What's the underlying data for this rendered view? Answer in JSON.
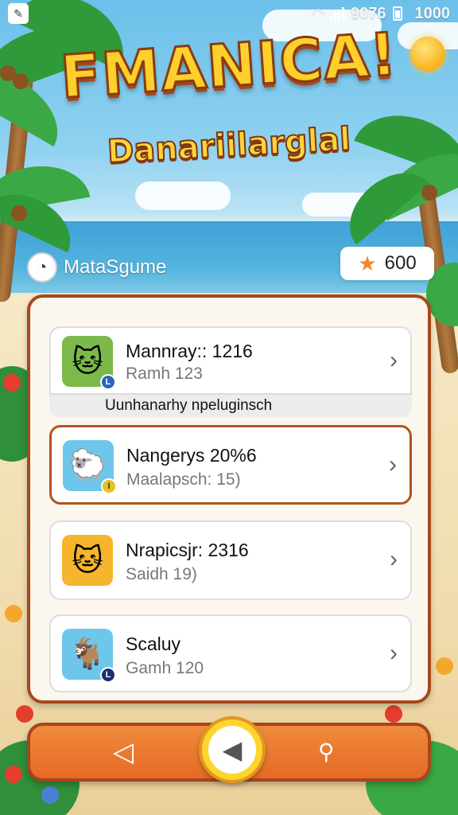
{
  "status_bar": {
    "time_text": "9076",
    "right_text": "1000"
  },
  "logo": {
    "title": "FMANICA!",
    "subtitle": "Danariilarglal"
  },
  "user": {
    "name": "MataSgume"
  },
  "coins": {
    "value": "600"
  },
  "list": [
    {
      "title": "Mannray:: 1216",
      "subtitle": "Ramh 123",
      "footer": "Uunhanarhy npeluginsch",
      "thumb_icon": "cat-icon",
      "thumb_bg": "#7bb94a",
      "badge": "L",
      "badge_color": "#2a63b8",
      "selected": false
    },
    {
      "title": "Nangerys 20%6",
      "subtitle": "Maalapsch: 15)",
      "thumb_icon": "sheep-icon",
      "thumb_bg": "#6ec7ea",
      "badge": "I",
      "badge_color": "#e6c21a",
      "selected": true
    },
    {
      "title": "Nrapicsjr: 2316",
      "subtitle": "Saidh 19)",
      "thumb_icon": "cat-icon",
      "thumb_bg": "#f5b52c",
      "badge": "",
      "badge_color": "",
      "selected": false
    },
    {
      "title": "Scaluy",
      "subtitle": "Gamh 120",
      "thumb_icon": "goat-icon",
      "thumb_bg": "#6ec7ea",
      "badge": "L",
      "badge_color": "#1c2e6e",
      "selected": false
    }
  ],
  "nav": {
    "left_icon": "back-triangle-icon",
    "center_icon": "play-back-icon",
    "right_icon": "search-icon"
  },
  "colors": {
    "panel_border": "#a8481a",
    "nav_orange": "#e56a26",
    "center_yellow": "#ffd42e"
  }
}
